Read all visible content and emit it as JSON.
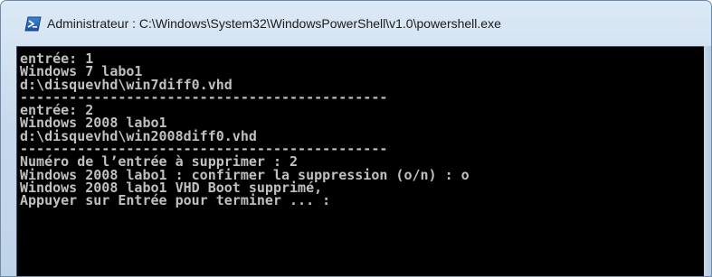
{
  "window": {
    "title": "Administrateur : C:\\Windows\\System32\\WindowsPowerShell\\v1.0\\powershell.exe",
    "icon": "powershell-icon"
  },
  "console": {
    "lines": [
      "entrée: 1",
      "Windows 7 labo1",
      "d:\\disquevhd\\win7diff0.vhd",
      "---------------------------------------------",
      "entrée: 2",
      "Windows 2008 labo1",
      "d:\\disquevhd\\win2008diff0.vhd",
      "---------------------------------------------",
      "Numéro de l’entrée à supprimer : 2",
      "Windows 2008 labo1 : confirmer la suppression (o/n) : o",
      "Windows 2008 labo1 VHD Boot supprimé,",
      "Appuyer sur Entrée pour terminer ... :"
    ]
  },
  "colors": {
    "console_background": "#000000",
    "console_text": "#c0c0c0",
    "titlebar": "#c7d9ec"
  }
}
